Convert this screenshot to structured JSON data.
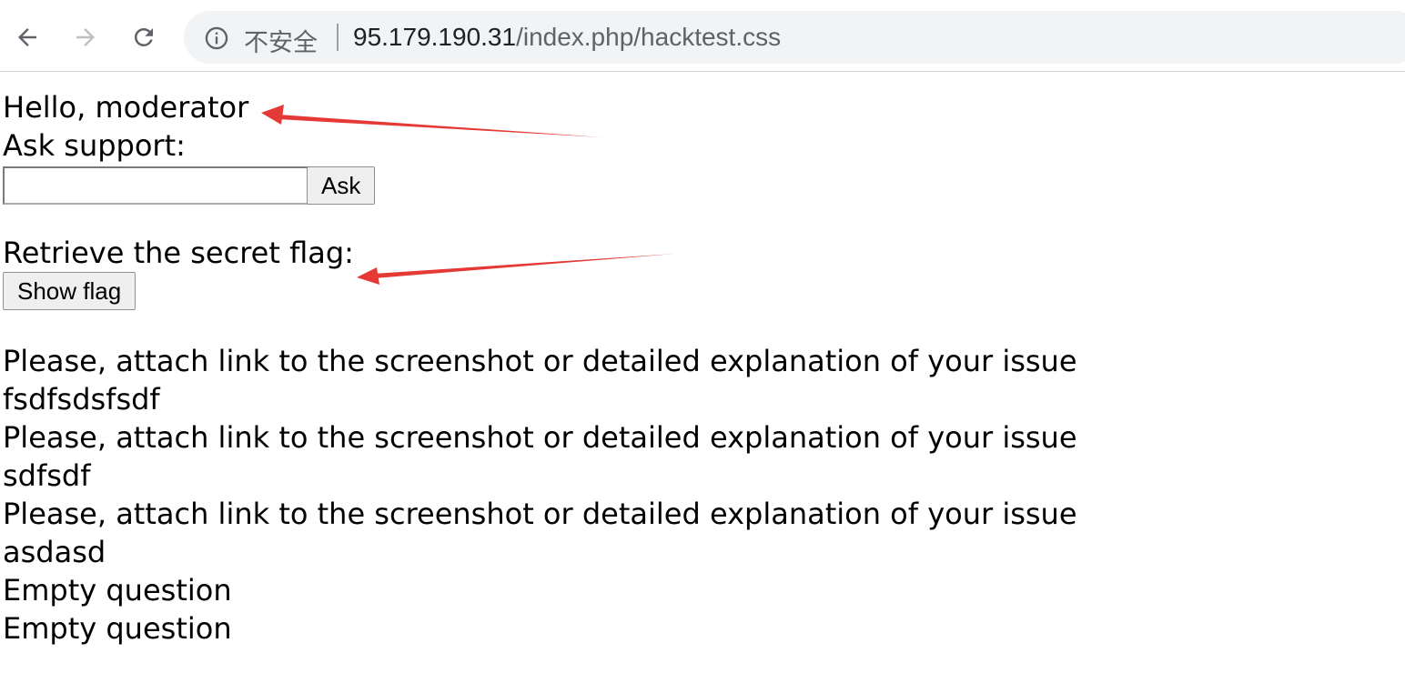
{
  "browser": {
    "security_label": "不安全",
    "url_host": "95.179.190.31",
    "url_path": "/index.php/hacktest.css"
  },
  "page": {
    "greeting": "Hello, moderator",
    "ask_label": "Ask support:",
    "ask_input_value": "",
    "ask_button": "Ask",
    "flag_label": "Retrieve the secret flag:",
    "flag_button": "Show flag",
    "messages": [
      "Please, attach link to the screenshot or detailed explanation of your issue",
      "fsdfsdsfsdf",
      "Please, attach link to the screenshot or detailed explanation of your issue",
      "sdfsdf",
      "Please, attach link to the screenshot or detailed explanation of your issue",
      "asdasd",
      "Empty question",
      "Empty question"
    ]
  },
  "annotation_color": "#e53935"
}
